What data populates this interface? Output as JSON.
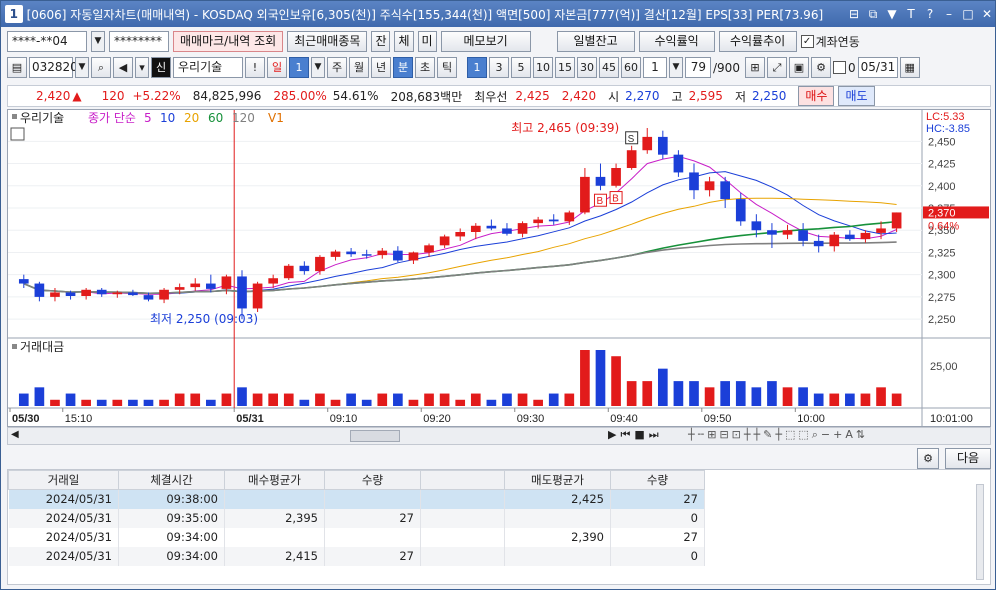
{
  "window": {
    "app_number": "1",
    "title": "[0606] 자동일자차트(매매내역) - KOSDAQ 외국인보유[6,305(천)] 주식수[155,344(천)] 액면[500] 자본금[777(억)] 결산[12월] EPS[33] PER[73.96]"
  },
  "toolbar1": {
    "account": "****-**04",
    "password": "********",
    "query_button": "매매마크/내역 조회",
    "recent_button": "최근매매종목",
    "btn_jan": "잔",
    "btn_che": "체",
    "btn_mi": "미",
    "memo_button": "메모보기",
    "daily_balance_button": "일별잔고",
    "profit_button": "수익률익",
    "profit_trend_button": "수익률추이",
    "account_link_label": "계좌연동"
  },
  "toolbar2": {
    "code": "032820",
    "stock_name": "우리기술",
    "exclaim": "!",
    "period_day": "일",
    "period_num": "1",
    "week": "주",
    "month": "월",
    "year": "년",
    "minute": "분",
    "second": "초",
    "tick": "틱",
    "intervals": [
      "1",
      "3",
      "5",
      "10",
      "15",
      "30",
      "45",
      "60"
    ],
    "interval_count": "1",
    "count_value": "79",
    "count_total": "/900",
    "d_label": "0",
    "date": "05/31"
  },
  "quote": {
    "price": "2,420",
    "arrow": "▲",
    "change": "120",
    "change_pct": "+5.22%",
    "volume": "84,825,996",
    "vol_ratio": "285.00%",
    "rotation": "54.61%",
    "amount": "208,683백만",
    "best_ask_label": "최우선",
    "best_ask": "2,425",
    "best_bid": "2,420",
    "open_label": "시",
    "open": "2,270",
    "high_label": "고",
    "high": "2,595",
    "low_label": "저",
    "low": "2,250",
    "buy_button": "매수",
    "sell_button": "매도"
  },
  "chart": {
    "legend_name": "우리기술",
    "legend_ma": "종가 단순",
    "ma_periods": [
      "5",
      "10",
      "20",
      "60",
      "120"
    ],
    "legend_v": "V1",
    "lc": "LC:5.33",
    "hc": "HC:-3.85",
    "current_price_tag": "2,370",
    "current_pct_tag": "0.64%",
    "high_annotation": "최고 2,465 (09:39)",
    "low_annotation": "최저 2,250 (09:03)",
    "volume_panel_title": "거래대금",
    "volume_axis_label": "25,00",
    "price_ticks": [
      "2,450",
      "2,425",
      "2,400",
      "2,375",
      "2,350",
      "2,325",
      "2,300",
      "2,275",
      "2,250"
    ],
    "time_labels": [
      "05/30",
      "15:10",
      "05/31",
      "09:10",
      "09:20",
      "09:30",
      "09:40",
      "09:50",
      "10:00"
    ],
    "time_right": "10:01:00",
    "colors": {
      "up": "#e21b1b",
      "down": "#1b3fd8",
      "ma5": "#c81fc8",
      "ma10": "#1b3fd8",
      "ma20": "#e8a300",
      "ma60": "#17913a",
      "ma120": "#808080",
      "orange": "#e07000"
    }
  },
  "chart_data": {
    "type": "candlestick",
    "price_range": [
      2240,
      2465
    ],
    "candles": [
      [
        2295,
        2300,
        2285,
        2290
      ],
      [
        2290,
        2292,
        2270,
        2275
      ],
      [
        2275,
        2285,
        2270,
        2280
      ],
      [
        2280,
        2282,
        2272,
        2276
      ],
      [
        2276,
        2285,
        2272,
        2283
      ],
      [
        2283,
        2285,
        2275,
        2278
      ],
      [
        2278,
        2282,
        2274,
        2280
      ],
      [
        2280,
        2283,
        2276,
        2277
      ],
      [
        2277,
        2280,
        2270,
        2272
      ],
      [
        2272,
        2285,
        2268,
        2283
      ],
      [
        2283,
        2290,
        2278,
        2286
      ],
      [
        2286,
        2296,
        2282,
        2290
      ],
      [
        2290,
        2300,
        2280,
        2284
      ],
      [
        2284,
        2300,
        2278,
        2298
      ],
      [
        2298,
        2305,
        2250,
        2262
      ],
      [
        2262,
        2292,
        2258,
        2290
      ],
      [
        2290,
        2300,
        2285,
        2296
      ],
      [
        2296,
        2312,
        2294,
        2310
      ],
      [
        2310,
        2315,
        2300,
        2304
      ],
      [
        2304,
        2322,
        2300,
        2320
      ],
      [
        2320,
        2328,
        2316,
        2326
      ],
      [
        2326,
        2330,
        2320,
        2323
      ],
      [
        2323,
        2328,
        2318,
        2322
      ],
      [
        2322,
        2330,
        2318,
        2327
      ],
      [
        2327,
        2332,
        2314,
        2316
      ],
      [
        2316,
        2326,
        2312,
        2325
      ],
      [
        2325,
        2335,
        2320,
        2333
      ],
      [
        2333,
        2345,
        2330,
        2343
      ],
      [
        2343,
        2352,
        2338,
        2348
      ],
      [
        2348,
        2358,
        2340,
        2355
      ],
      [
        2355,
        2362,
        2350,
        2352
      ],
      [
        2352,
        2358,
        2344,
        2346
      ],
      [
        2346,
        2360,
        2342,
        2358
      ],
      [
        2358,
        2365,
        2352,
        2362
      ],
      [
        2362,
        2368,
        2356,
        2360
      ],
      [
        2360,
        2372,
        2356,
        2370
      ],
      [
        2370,
        2420,
        2368,
        2410
      ],
      [
        2410,
        2425,
        2395,
        2400
      ],
      [
        2400,
        2425,
        2398,
        2420
      ],
      [
        2420,
        2445,
        2418,
        2440
      ],
      [
        2440,
        2465,
        2436,
        2455
      ],
      [
        2455,
        2462,
        2430,
        2435
      ],
      [
        2435,
        2440,
        2410,
        2415
      ],
      [
        2415,
        2425,
        2385,
        2395
      ],
      [
        2395,
        2410,
        2388,
        2405
      ],
      [
        2405,
        2410,
        2375,
        2385
      ],
      [
        2385,
        2392,
        2355,
        2360
      ],
      [
        2360,
        2368,
        2342,
        2350
      ],
      [
        2350,
        2358,
        2330,
        2345
      ],
      [
        2345,
        2356,
        2340,
        2350
      ],
      [
        2350,
        2358,
        2332,
        2338
      ],
      [
        2338,
        2345,
        2325,
        2332
      ],
      [
        2332,
        2348,
        2326,
        2345
      ],
      [
        2345,
        2350,
        2338,
        2340
      ],
      [
        2340,
        2350,
        2336,
        2347
      ],
      [
        2347,
        2360,
        2340,
        2352
      ],
      [
        2352,
        2370,
        2348,
        2370
      ]
    ],
    "volume": [
      2,
      3,
      1,
      2,
      1,
      1,
      1,
      1,
      1,
      1,
      2,
      2,
      1,
      2,
      3,
      2,
      2,
      2,
      1,
      2,
      1,
      2,
      1,
      2,
      2,
      1,
      2,
      2,
      1,
      2,
      1,
      2,
      2,
      1,
      2,
      2,
      9,
      9,
      8,
      4,
      4,
      6,
      4,
      4,
      3,
      4,
      4,
      3,
      4,
      3,
      3,
      2,
      2,
      2,
      2,
      3,
      2
    ],
    "volume_unit": "거래대금"
  },
  "trades": {
    "headers": [
      "거래일",
      "체결시간",
      "매수평균가",
      "수량",
      "",
      "매도평균가",
      "수량"
    ],
    "rows": [
      [
        "2024/05/31",
        "09:38:00",
        "",
        "",
        "",
        "2,425",
        "27"
      ],
      [
        "2024/05/31",
        "09:35:00",
        "2,395",
        "27",
        "",
        "",
        "0"
      ],
      [
        "2024/05/31",
        "09:34:00",
        "",
        "",
        "",
        "2,390",
        "27"
      ],
      [
        "2024/05/31",
        "09:34:00",
        "2,415",
        "27",
        "",
        "",
        "0"
      ]
    ],
    "next_button": "다음"
  }
}
